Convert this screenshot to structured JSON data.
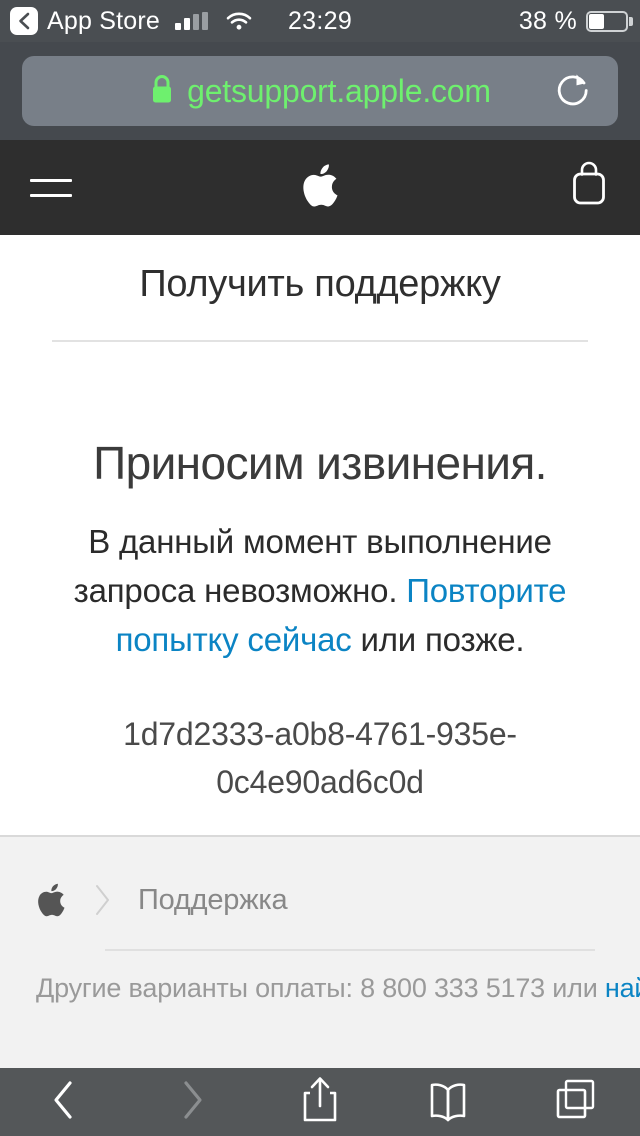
{
  "status_bar": {
    "back_label": "App Store",
    "back_icon": "chevron-left-icon",
    "signal_icon": "cellular-signal-icon",
    "signal_bars_filled": 2,
    "signal_bars_total": 4,
    "wifi_icon": "wifi-icon",
    "time": "23:29",
    "battery_percent": "38 %",
    "battery_level": 38,
    "battery_icon": "battery-icon"
  },
  "browser": {
    "url": "getsupport.apple.com",
    "lock_icon": "lock-icon",
    "lock_color": "#6ef06e",
    "url_color": "#6ef06e",
    "reload_icon": "reload-icon",
    "bar_color": "#787f88"
  },
  "site_nav": {
    "menu_icon": "hamburger-menu-icon",
    "logo_icon": "apple-logo-icon",
    "bag_icon": "shopping-bag-icon",
    "bar_color": "#2e2e2e"
  },
  "page": {
    "title": "Получить поддержку",
    "apology_heading": "Приносим извинения.",
    "message_before_link": "В данный момент выполнение запроса невозможно. ",
    "message_link": "Повторите попытку сейчас",
    "message_after_link": " или позже.",
    "error_id": "1d7d2333-a0b8-4761-935e-0c4e90ad6c0d",
    "link_color": "#0b84c4"
  },
  "footer": {
    "apple_icon": "apple-logo-icon",
    "chevron_icon": "chevron-right-icon",
    "breadcrumb_label": "Поддержка",
    "note_text": "Другие варианты оплаты: 8 800 333 5173 или ",
    "note_link": "найдите",
    "background": "#f2f2f2"
  },
  "toolbar": {
    "back_icon": "chevron-left-icon",
    "forward_icon": "chevron-right-icon",
    "share_icon": "share-icon",
    "bookmarks_icon": "book-icon",
    "tabs_icon": "tabs-icon",
    "back_enabled": true,
    "forward_enabled": false,
    "bar_color": "#545759"
  }
}
